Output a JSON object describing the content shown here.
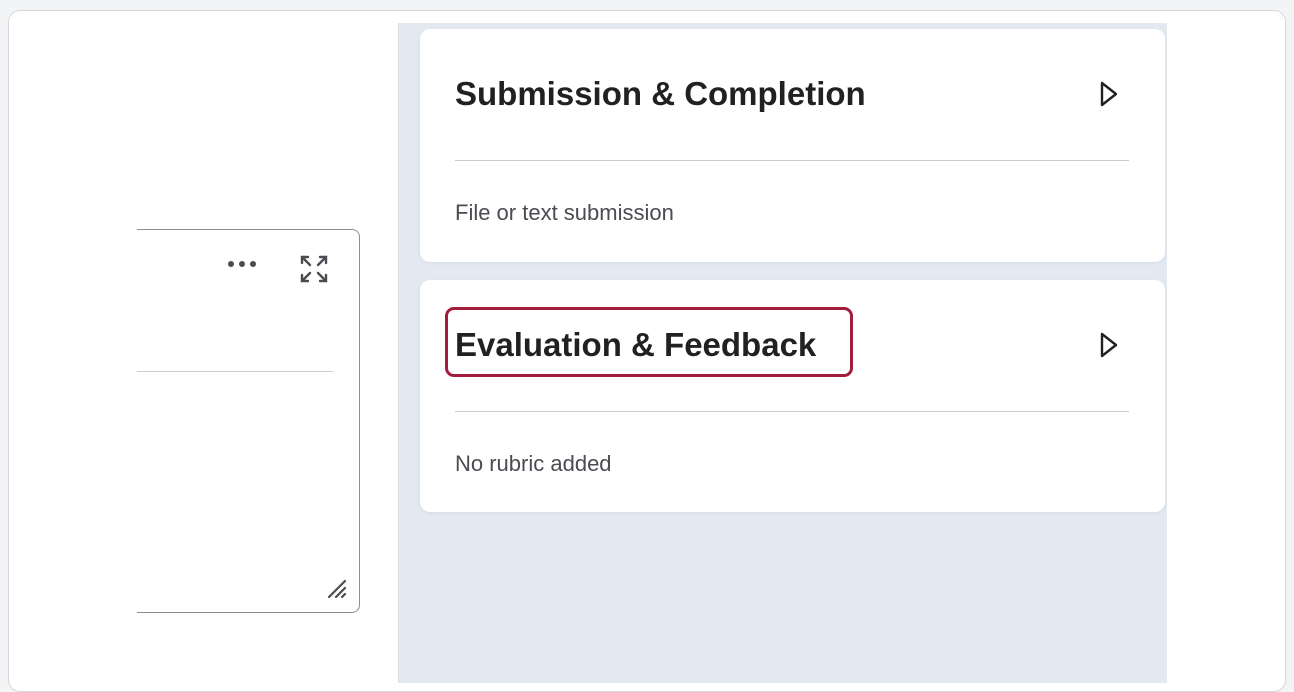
{
  "cards": [
    {
      "title": "Submission & Completion",
      "summary": "File or text submission"
    },
    {
      "title": "Evaluation & Feedback",
      "summary": "No rubric added"
    }
  ],
  "icons": {
    "more": "more-horizontal-icon",
    "fullscreen": "fullscreen-icon",
    "resize": "resize-handle-icon",
    "expand": "chevron-right-outline-icon"
  },
  "colors": {
    "highlight": "#a21c3c",
    "panel_bg": "#e3e9f1",
    "card_bg": "#ffffff",
    "title": "#202122"
  }
}
